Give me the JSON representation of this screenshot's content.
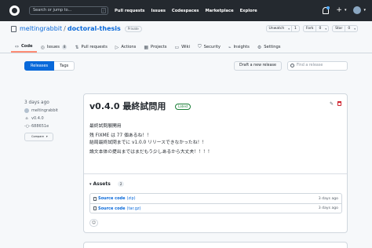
{
  "header": {
    "search_placeholder": "Search or jump to...",
    "search_shortcut": "/",
    "nav": [
      "Pull requests",
      "Issues",
      "Codespaces",
      "Marketplace",
      "Explore"
    ],
    "plus_symbol": "+",
    "caret": "▾"
  },
  "repo": {
    "owner": "meltingrabbit",
    "separator": "/",
    "name": "doctoral-thesis",
    "visibility": "Private",
    "unwatch_label": "Unwatch",
    "unwatch_count": "1",
    "fork_label": "Fork",
    "fork_count": "0",
    "star_label": "Star",
    "star_count": "0",
    "dropdown": "▾"
  },
  "tabs": [
    {
      "label": "Code",
      "icon": "‹›"
    },
    {
      "label": "Issues",
      "icon": "◎",
      "badge": "8"
    },
    {
      "label": "Pull requests",
      "icon": "⇅"
    },
    {
      "label": "Actions",
      "icon": "▷"
    },
    {
      "label": "Projects",
      "icon": "▦"
    },
    {
      "label": "Wiki",
      "icon": "▭"
    },
    {
      "label": "Security",
      "icon": "⛉"
    },
    {
      "label": "Insights",
      "icon": "⌁"
    },
    {
      "label": "Settings",
      "icon": "⚙"
    }
  ],
  "subnav": {
    "releases": "Releases",
    "tags": "Tags",
    "draft_button": "Draft a new release",
    "find_placeholder": "Find a release"
  },
  "release": {
    "time_ago": "3 days ago",
    "author": "meltingrabbit",
    "tag": "v0.4.0",
    "commit": "688651e",
    "compare": "Compare",
    "title": "v0.4.0 最終試問用",
    "latest_badge": "Latest",
    "body": [
      "最終試問展開用",
      "残 FIXME は 77 個あるね！！",
      "結局最終試問までに v1.0.0 リリースできなかったね！！",
      "論文本体の提出まではまだもう少しあるから大丈夫！！！！"
    ],
    "assets_label": "Assets",
    "assets_count": "2",
    "assets": [
      {
        "name": "Source code",
        "ext": "(zip)",
        "time": "3 days ago"
      },
      {
        "name": "Source code",
        "ext": "(tar.gz)",
        "time": "3 days ago"
      }
    ],
    "reaction_icon": "☺",
    "edit_icon": "✎"
  },
  "colors": {
    "header_bg": "#24292f",
    "link": "#0969da",
    "latest": "#1a7f37",
    "tab_underline": "#fd8c73"
  }
}
